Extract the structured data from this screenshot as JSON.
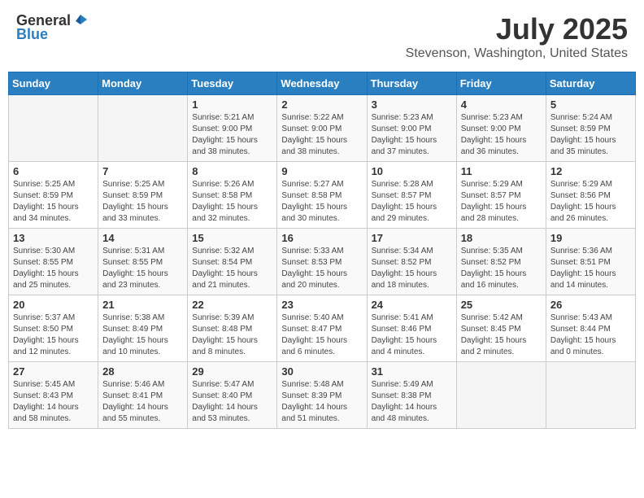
{
  "header": {
    "logo_general": "General",
    "logo_blue": "Blue",
    "month": "July 2025",
    "location": "Stevenson, Washington, United States"
  },
  "days_of_week": [
    "Sunday",
    "Monday",
    "Tuesday",
    "Wednesday",
    "Thursday",
    "Friday",
    "Saturday"
  ],
  "weeks": [
    [
      {
        "day": "",
        "info": ""
      },
      {
        "day": "",
        "info": ""
      },
      {
        "day": "1",
        "info": "Sunrise: 5:21 AM\nSunset: 9:00 PM\nDaylight: 15 hours and 38 minutes."
      },
      {
        "day": "2",
        "info": "Sunrise: 5:22 AM\nSunset: 9:00 PM\nDaylight: 15 hours and 38 minutes."
      },
      {
        "day": "3",
        "info": "Sunrise: 5:23 AM\nSunset: 9:00 PM\nDaylight: 15 hours and 37 minutes."
      },
      {
        "day": "4",
        "info": "Sunrise: 5:23 AM\nSunset: 9:00 PM\nDaylight: 15 hours and 36 minutes."
      },
      {
        "day": "5",
        "info": "Sunrise: 5:24 AM\nSunset: 8:59 PM\nDaylight: 15 hours and 35 minutes."
      }
    ],
    [
      {
        "day": "6",
        "info": "Sunrise: 5:25 AM\nSunset: 8:59 PM\nDaylight: 15 hours and 34 minutes."
      },
      {
        "day": "7",
        "info": "Sunrise: 5:25 AM\nSunset: 8:59 PM\nDaylight: 15 hours and 33 minutes."
      },
      {
        "day": "8",
        "info": "Sunrise: 5:26 AM\nSunset: 8:58 PM\nDaylight: 15 hours and 32 minutes."
      },
      {
        "day": "9",
        "info": "Sunrise: 5:27 AM\nSunset: 8:58 PM\nDaylight: 15 hours and 30 minutes."
      },
      {
        "day": "10",
        "info": "Sunrise: 5:28 AM\nSunset: 8:57 PM\nDaylight: 15 hours and 29 minutes."
      },
      {
        "day": "11",
        "info": "Sunrise: 5:29 AM\nSunset: 8:57 PM\nDaylight: 15 hours and 28 minutes."
      },
      {
        "day": "12",
        "info": "Sunrise: 5:29 AM\nSunset: 8:56 PM\nDaylight: 15 hours and 26 minutes."
      }
    ],
    [
      {
        "day": "13",
        "info": "Sunrise: 5:30 AM\nSunset: 8:55 PM\nDaylight: 15 hours and 25 minutes."
      },
      {
        "day": "14",
        "info": "Sunrise: 5:31 AM\nSunset: 8:55 PM\nDaylight: 15 hours and 23 minutes."
      },
      {
        "day": "15",
        "info": "Sunrise: 5:32 AM\nSunset: 8:54 PM\nDaylight: 15 hours and 21 minutes."
      },
      {
        "day": "16",
        "info": "Sunrise: 5:33 AM\nSunset: 8:53 PM\nDaylight: 15 hours and 20 minutes."
      },
      {
        "day": "17",
        "info": "Sunrise: 5:34 AM\nSunset: 8:52 PM\nDaylight: 15 hours and 18 minutes."
      },
      {
        "day": "18",
        "info": "Sunrise: 5:35 AM\nSunset: 8:52 PM\nDaylight: 15 hours and 16 minutes."
      },
      {
        "day": "19",
        "info": "Sunrise: 5:36 AM\nSunset: 8:51 PM\nDaylight: 15 hours and 14 minutes."
      }
    ],
    [
      {
        "day": "20",
        "info": "Sunrise: 5:37 AM\nSunset: 8:50 PM\nDaylight: 15 hours and 12 minutes."
      },
      {
        "day": "21",
        "info": "Sunrise: 5:38 AM\nSunset: 8:49 PM\nDaylight: 15 hours and 10 minutes."
      },
      {
        "day": "22",
        "info": "Sunrise: 5:39 AM\nSunset: 8:48 PM\nDaylight: 15 hours and 8 minutes."
      },
      {
        "day": "23",
        "info": "Sunrise: 5:40 AM\nSunset: 8:47 PM\nDaylight: 15 hours and 6 minutes."
      },
      {
        "day": "24",
        "info": "Sunrise: 5:41 AM\nSunset: 8:46 PM\nDaylight: 15 hours and 4 minutes."
      },
      {
        "day": "25",
        "info": "Sunrise: 5:42 AM\nSunset: 8:45 PM\nDaylight: 15 hours and 2 minutes."
      },
      {
        "day": "26",
        "info": "Sunrise: 5:43 AM\nSunset: 8:44 PM\nDaylight: 15 hours and 0 minutes."
      }
    ],
    [
      {
        "day": "27",
        "info": "Sunrise: 5:45 AM\nSunset: 8:43 PM\nDaylight: 14 hours and 58 minutes."
      },
      {
        "day": "28",
        "info": "Sunrise: 5:46 AM\nSunset: 8:41 PM\nDaylight: 14 hours and 55 minutes."
      },
      {
        "day": "29",
        "info": "Sunrise: 5:47 AM\nSunset: 8:40 PM\nDaylight: 14 hours and 53 minutes."
      },
      {
        "day": "30",
        "info": "Sunrise: 5:48 AM\nSunset: 8:39 PM\nDaylight: 14 hours and 51 minutes."
      },
      {
        "day": "31",
        "info": "Sunrise: 5:49 AM\nSunset: 8:38 PM\nDaylight: 14 hours and 48 minutes."
      },
      {
        "day": "",
        "info": ""
      },
      {
        "day": "",
        "info": ""
      }
    ]
  ]
}
